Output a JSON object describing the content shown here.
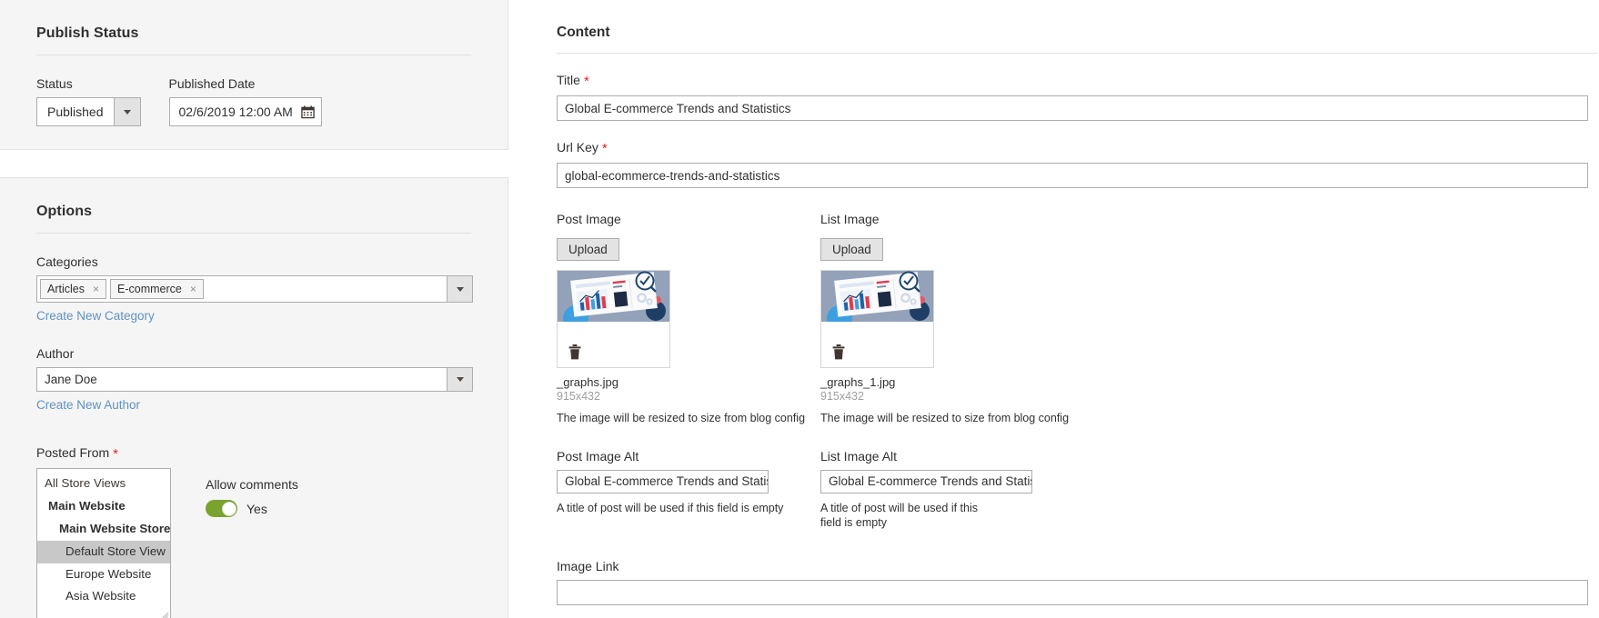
{
  "publish": {
    "section_title": "Publish Status",
    "status": {
      "label": "Status",
      "value": "Published"
    },
    "published_date": {
      "label": "Published Date",
      "value": "02/6/2019 12:00 AM",
      "icon": "calendar-icon"
    }
  },
  "options": {
    "section_title": "Options",
    "categories": {
      "label": "Categories",
      "chips": [
        {
          "label": "Articles",
          "remove": "×"
        },
        {
          "label": "E-commerce",
          "remove": "×"
        }
      ],
      "create_link": "Create New Category"
    },
    "author": {
      "label": "Author",
      "value": "Jane Doe",
      "create_link": "Create New Author"
    },
    "posted_from": {
      "label": "Posted From",
      "required_marker": "*",
      "items": [
        {
          "label": "All Store Views",
          "level": 0,
          "selected": false
        },
        {
          "label": "Main Website",
          "level": 1,
          "selected": false
        },
        {
          "label": "Main Website Store",
          "level": 2,
          "selected": false
        },
        {
          "label": "Default Store View",
          "level": 3,
          "selected": true
        },
        {
          "label": "Europe Website",
          "level": 3,
          "selected": false
        },
        {
          "label": "Asia Website",
          "level": 3,
          "selected": false
        }
      ]
    },
    "allow_comments": {
      "label": "Allow comments",
      "state_label": "Yes",
      "on": true,
      "on_color": "#79a22e"
    }
  },
  "content": {
    "section_title": "Content",
    "title_field": {
      "label": "Title",
      "required_marker": "*",
      "value": "Global E-commerce Trends and Statistics"
    },
    "url_key_field": {
      "label": "Url Key",
      "required_marker": "*",
      "value": "global-ecommerce-trends-and-statistics"
    },
    "post_image": {
      "label": "Post Image",
      "upload_label": "Upload",
      "file_name": "_graphs.jpg",
      "dimensions": "915x432",
      "hint": "The image will be resized to size from blog config",
      "delete_icon": "trash-icon"
    },
    "list_image": {
      "label": "List Image",
      "upload_label": "Upload",
      "file_name": "_graphs_1.jpg",
      "dimensions": "915x432",
      "hint": "The image will be resized to size from blog config",
      "delete_icon": "trash-icon"
    },
    "post_image_alt": {
      "label": "Post Image Alt",
      "value": "Global E-commerce Trends and Statistic",
      "hint": "A title of post will be used if this field is empty"
    },
    "list_image_alt": {
      "label": "List Image Alt",
      "value": "Global E-commerce Trends and Statisti",
      "hint": "A title of post will be used if this field is empty"
    },
    "image_link": {
      "label": "Image Link",
      "value": "",
      "placeholder": ""
    }
  },
  "colors": {
    "panel_bg": "#f5f5f5",
    "border": "#adadad",
    "link": "#5f92c0",
    "required": "#e22626",
    "toggle_on": "#79a22e",
    "selected_row": "#c8c8c8"
  }
}
